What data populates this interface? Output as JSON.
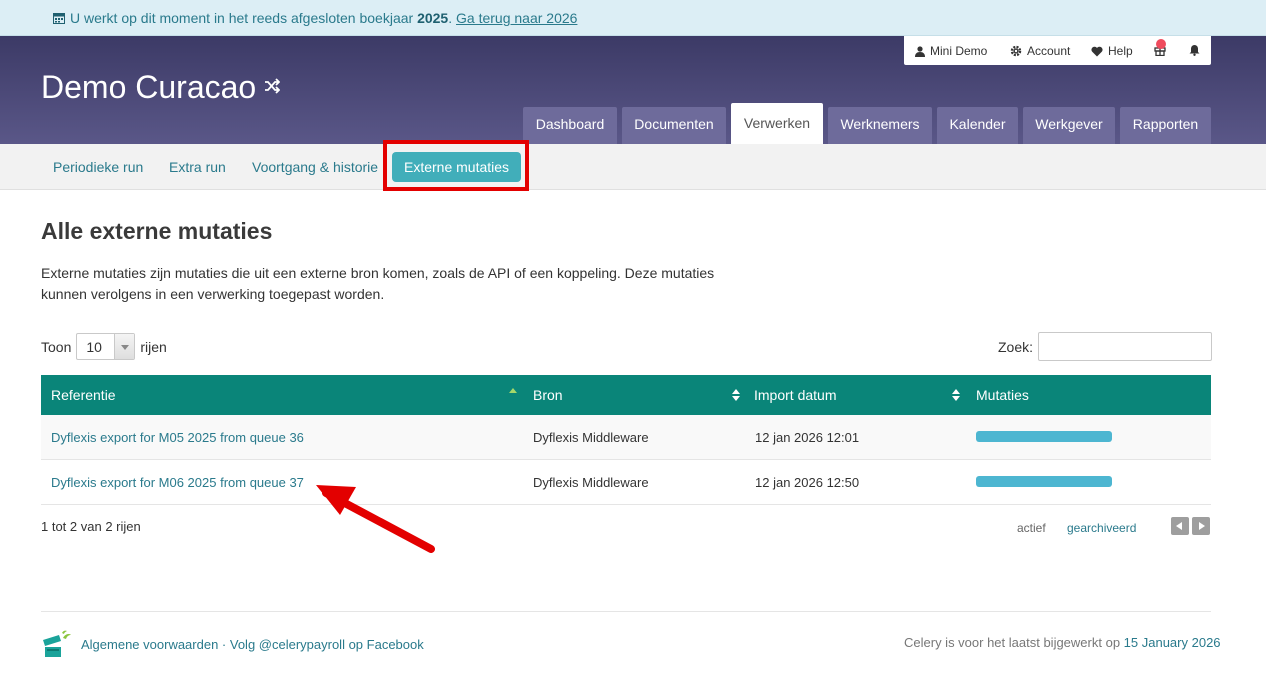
{
  "banner": {
    "icon": "calendar-icon",
    "text": "U werkt op dit moment in het reeds afgesloten boekjaar",
    "year": "2025",
    "dot": ".",
    "back_link": "Ga terug naar 2026"
  },
  "header": {
    "company": "Demo Curacao",
    "company_icon": "shuffle-icon",
    "topbar": {
      "user": "Mini Demo",
      "account": "Account",
      "help": "Help"
    },
    "tabs": [
      "Dashboard",
      "Documenten",
      "Verwerken",
      "Werknemers",
      "Kalender",
      "Werkgever",
      "Rapporten"
    ],
    "active_tab": "Verwerken"
  },
  "subnav": {
    "items": [
      "Periodieke run",
      "Extra run",
      "Voortgang & historie",
      "Externe mutaties"
    ],
    "active_item": "Externe mutaties"
  },
  "main": {
    "title": "Alle externe mutaties",
    "description": "Externe mutaties zijn mutaties die uit een externe bron komen, zoals de API of een koppeling. Deze mutaties kunnen verolgens in een verwerking toegepast worden.",
    "show_label": "Toon",
    "show_value": "10",
    "rows_label": "rijen",
    "search_label": "Zoek:",
    "search_value": ""
  },
  "table": {
    "columns": [
      "Referentie",
      "Bron",
      "Import datum",
      "Mutaties"
    ],
    "rows": [
      {
        "referentie": "Dyflexis export for M05 2025 from queue 36",
        "bron": "Dyflexis Middleware",
        "datum": "12 jan 2026 12:01",
        "mutaties": 1.0
      },
      {
        "referentie": "Dyflexis export for M06 2025 from queue 37",
        "bron": "Dyflexis Middleware",
        "datum": "12 jan 2026 12:50",
        "mutaties": 1.0
      }
    ],
    "info": "1 tot 2 van 2 rijen",
    "filter_active": "actief",
    "filter_archived": "gearchiveerd"
  },
  "footer": {
    "terms": "Algemene voorwaarden",
    "separator": " · ",
    "follow": "Volg @celerypayroll op Facebook",
    "updated_text": "Celery is voor het laatst bijgewerkt op",
    "updated_date": "15 January 2026"
  },
  "colors": {
    "header": "#4b4878",
    "table_header": "#0a8579",
    "accent": "#41aeba",
    "highlight": "#e30000"
  }
}
